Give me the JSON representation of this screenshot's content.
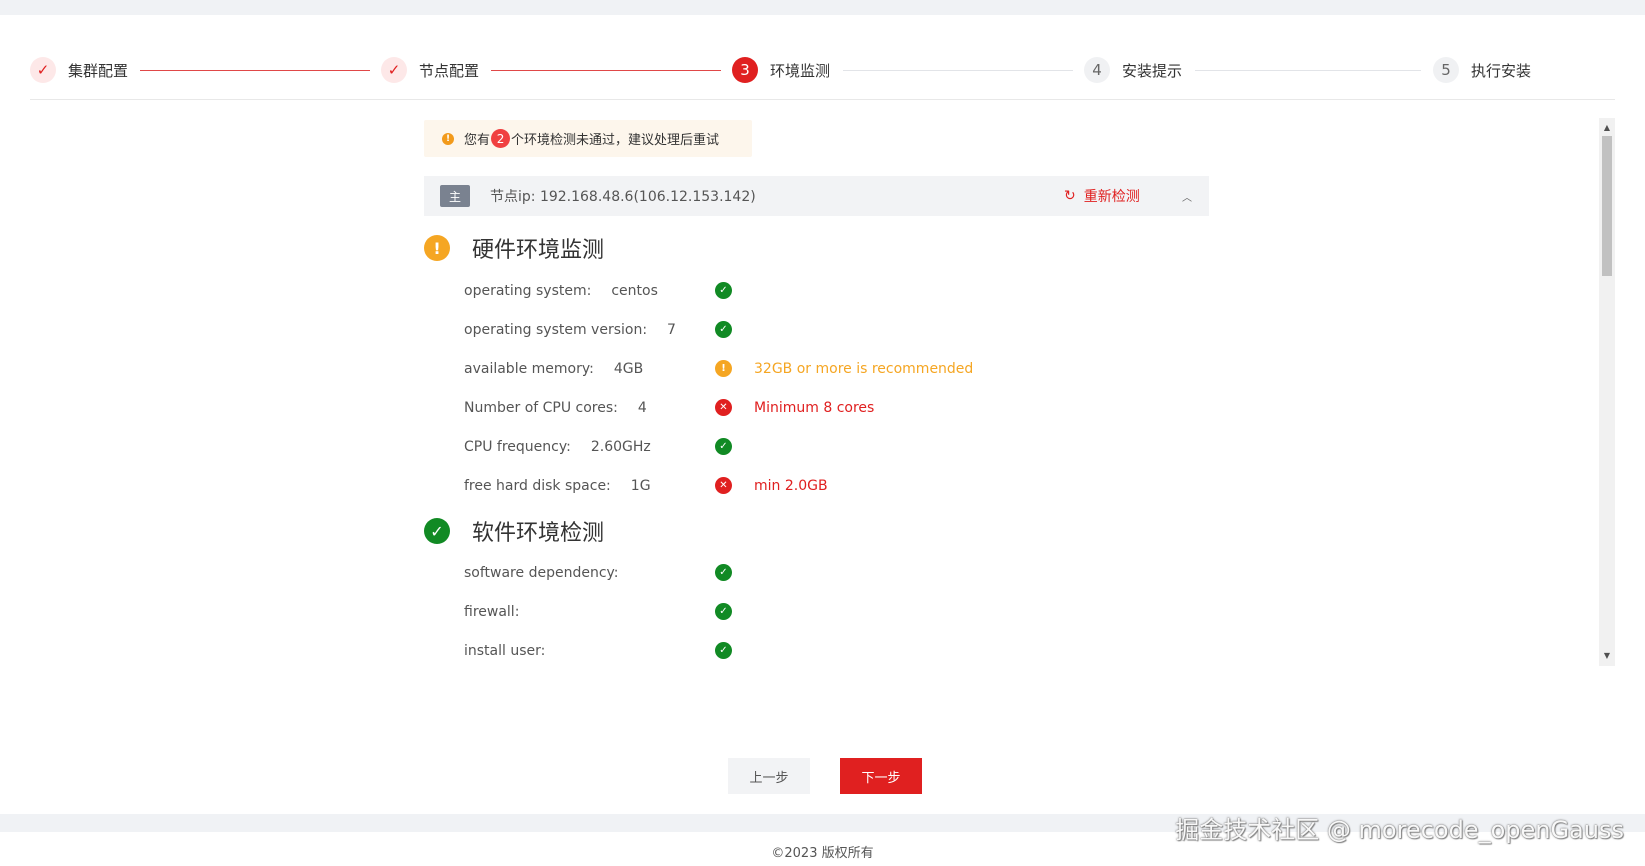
{
  "steps": [
    {
      "index": "✓",
      "label": "集群配置",
      "state": "done"
    },
    {
      "index": "✓",
      "label": "节点配置",
      "state": "done"
    },
    {
      "index": "3",
      "label": "环境监测",
      "state": "active"
    },
    {
      "index": "4",
      "label": "安装提示",
      "state": "todo"
    },
    {
      "index": "5",
      "label": "执行安装",
      "state": "todo"
    }
  ],
  "alert": {
    "icon": "warning-icon",
    "prefix": "您有",
    "count": "2",
    "suffix": "个环境检测未通过，建议处理后重试"
  },
  "node": {
    "badge": "主",
    "ip_text": "节点ip: 192.168.48.6(106.12.153.142)",
    "recheck_label": "重新检测"
  },
  "hardware": {
    "title": "硬件环境监测",
    "status": "warn",
    "rows": [
      {
        "label": "operating system:",
        "value": "centos",
        "status": "ok",
        "message": ""
      },
      {
        "label": "operating system version:",
        "value": "7",
        "status": "ok",
        "message": ""
      },
      {
        "label": "available memory:",
        "value": "4GB",
        "status": "warn",
        "message": "32GB or more is recommended"
      },
      {
        "label": "Number of CPU cores:",
        "value": "4",
        "status": "err",
        "message": "Minimum 8 cores"
      },
      {
        "label": "CPU frequency:",
        "value": "2.60GHz",
        "status": "ok",
        "message": ""
      },
      {
        "label": "free hard disk space:",
        "value": "1G",
        "status": "err",
        "message": "min 2.0GB"
      }
    ]
  },
  "software": {
    "title": "软件环境检测",
    "status": "ok",
    "rows": [
      {
        "label": "software dependency:",
        "value": "",
        "status": "ok",
        "message": ""
      },
      {
        "label": "firewall:",
        "value": "",
        "status": "ok",
        "message": ""
      },
      {
        "label": "install user:",
        "value": "",
        "status": "ok",
        "message": ""
      }
    ]
  },
  "buttons": {
    "prev_label": "上一步",
    "next_label": "下一步"
  },
  "footer": {
    "copyright": "©2023 版权所有"
  },
  "watermark": "掘金技术社区 @ morecode_openGauss",
  "colors": {
    "accent": "#e02020",
    "ok": "#118a24",
    "warn": "#f5a623",
    "alert_bg": "#fdf6ec"
  }
}
